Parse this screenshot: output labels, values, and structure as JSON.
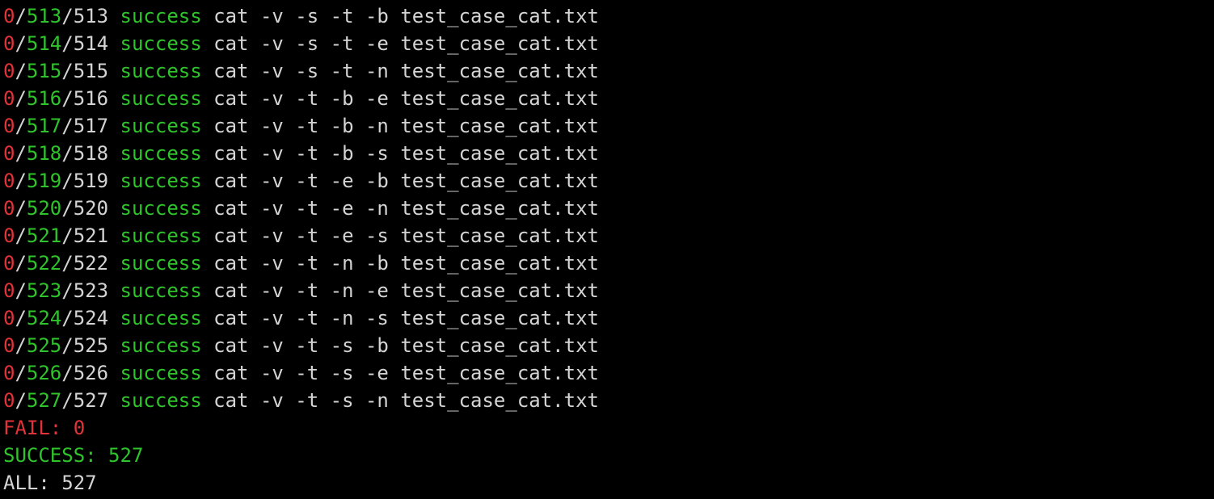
{
  "colors": {
    "background": "#000000",
    "text": "#d4d4d4",
    "fail_red": "#e0333a",
    "success_green": "#2fc42b"
  },
  "lines": [
    {
      "fail": "0",
      "current": "513",
      "total": "513",
      "status": "success",
      "command": "cat -v -s -t -b test_case_cat.txt"
    },
    {
      "fail": "0",
      "current": "514",
      "total": "514",
      "status": "success",
      "command": "cat -v -s -t -e test_case_cat.txt"
    },
    {
      "fail": "0",
      "current": "515",
      "total": "515",
      "status": "success",
      "command": "cat -v -s -t -n test_case_cat.txt"
    },
    {
      "fail": "0",
      "current": "516",
      "total": "516",
      "status": "success",
      "command": "cat -v -t -b -e test_case_cat.txt"
    },
    {
      "fail": "0",
      "current": "517",
      "total": "517",
      "status": "success",
      "command": "cat -v -t -b -n test_case_cat.txt"
    },
    {
      "fail": "0",
      "current": "518",
      "total": "518",
      "status": "success",
      "command": "cat -v -t -b -s test_case_cat.txt"
    },
    {
      "fail": "0",
      "current": "519",
      "total": "519",
      "status": "success",
      "command": "cat -v -t -e -b test_case_cat.txt"
    },
    {
      "fail": "0",
      "current": "520",
      "total": "520",
      "status": "success",
      "command": "cat -v -t -e -n test_case_cat.txt"
    },
    {
      "fail": "0",
      "current": "521",
      "total": "521",
      "status": "success",
      "command": "cat -v -t -e -s test_case_cat.txt"
    },
    {
      "fail": "0",
      "current": "522",
      "total": "522",
      "status": "success",
      "command": "cat -v -t -n -b test_case_cat.txt"
    },
    {
      "fail": "0",
      "current": "523",
      "total": "523",
      "status": "success",
      "command": "cat -v -t -n -e test_case_cat.txt"
    },
    {
      "fail": "0",
      "current": "524",
      "total": "524",
      "status": "success",
      "command": "cat -v -t -n -s test_case_cat.txt"
    },
    {
      "fail": "0",
      "current": "525",
      "total": "525",
      "status": "success",
      "command": "cat -v -t -s -b test_case_cat.txt"
    },
    {
      "fail": "0",
      "current": "526",
      "total": "526",
      "status": "success",
      "command": "cat -v -t -s -e test_case_cat.txt"
    },
    {
      "fail": "0",
      "current": "527",
      "total": "527",
      "status": "success",
      "command": "cat -v -t -s -n test_case_cat.txt"
    }
  ],
  "summary": {
    "fail": "FAIL: 0",
    "success": "SUCCESS: 527",
    "all": "ALL: 527"
  }
}
